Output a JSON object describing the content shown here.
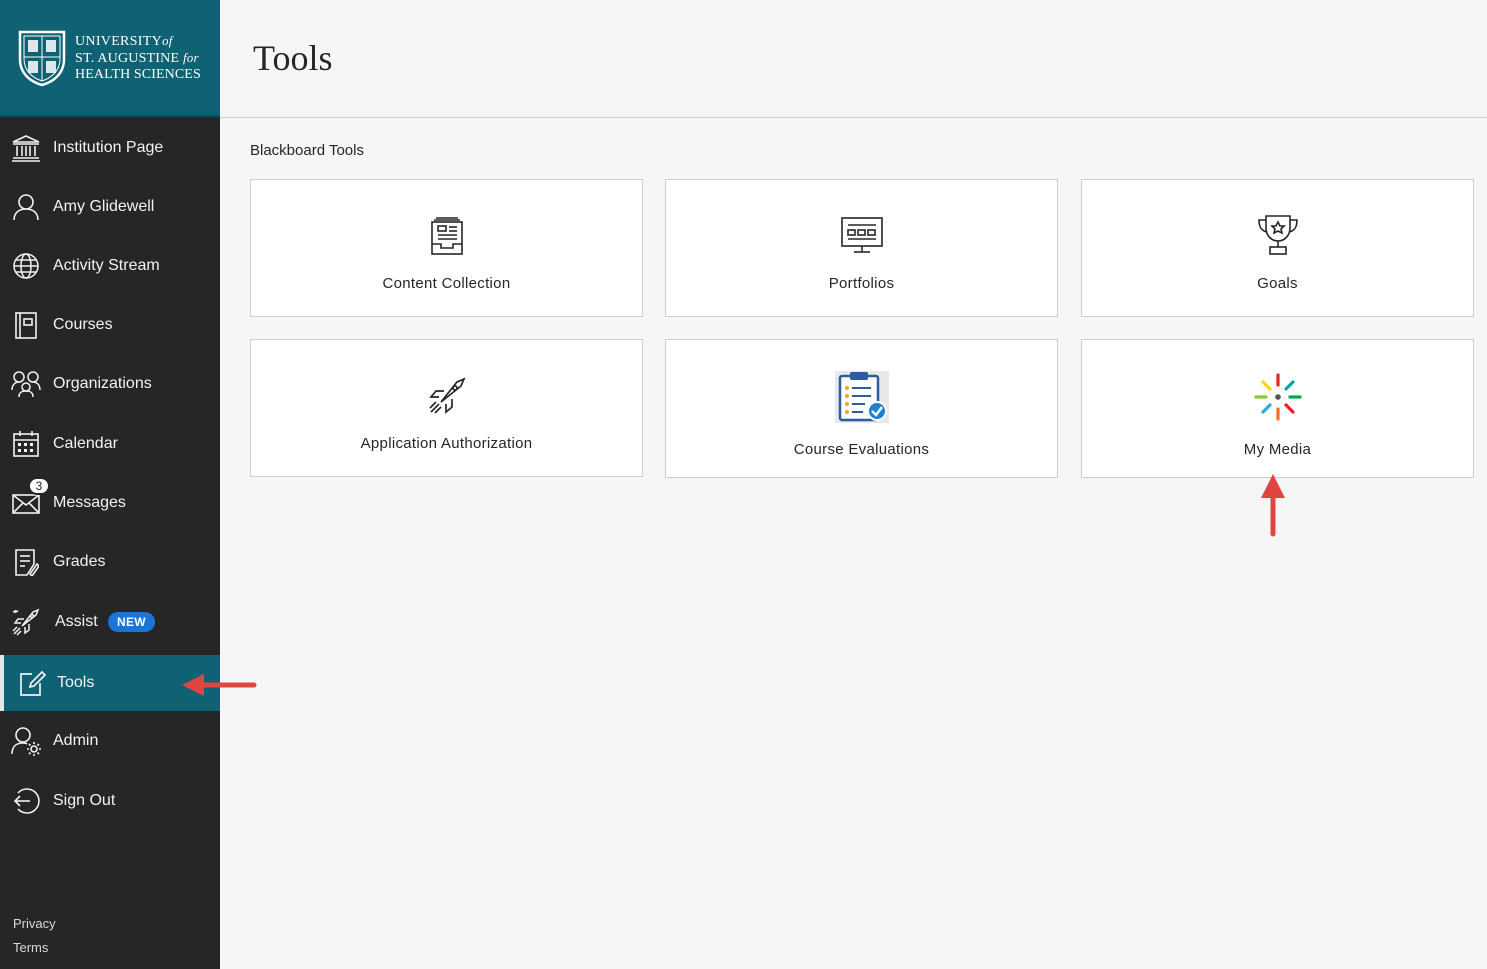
{
  "brand": {
    "line1": "University",
    "line1_suffix": "of",
    "line2": "St. Augustine",
    "line2_suffix": "for",
    "line3": "Health Sciences",
    "bg_color": "#0f6273"
  },
  "sidebar": {
    "items": [
      {
        "label": "Institution Page",
        "icon": "institution-icon"
      },
      {
        "label": "Amy Glidewell",
        "icon": "user-icon"
      },
      {
        "label": "Activity Stream",
        "icon": "globe-icon"
      },
      {
        "label": "Courses",
        "icon": "book-icon"
      },
      {
        "label": "Organizations",
        "icon": "group-icon"
      },
      {
        "label": "Calendar",
        "icon": "calendar-icon"
      },
      {
        "label": "Messages",
        "icon": "envelope-icon",
        "count": "3"
      },
      {
        "label": "Grades",
        "icon": "grades-icon"
      },
      {
        "label": "Assist",
        "icon": "rocket-icon",
        "badge": "NEW"
      },
      {
        "label": "Tools",
        "icon": "tools-icon",
        "active": true
      },
      {
        "label": "Admin",
        "icon": "admin-icon"
      },
      {
        "label": "Sign Out",
        "icon": "sign-out-icon"
      }
    ],
    "footer": {
      "privacy": "Privacy",
      "terms": "Terms"
    },
    "active_color": "#0f6273",
    "badge_color": "#1b74d6"
  },
  "main": {
    "title": "Tools",
    "section": "Blackboard Tools",
    "tiles": [
      {
        "label": "Content Collection",
        "icon": "content-collection-icon"
      },
      {
        "label": "Portfolios",
        "icon": "portfolio-icon"
      },
      {
        "label": "Goals",
        "icon": "trophy-icon"
      },
      {
        "label": "Application Authorization",
        "icon": "rocket-icon"
      },
      {
        "label": "Course Evaluations",
        "icon": "clipboard-check-icon"
      },
      {
        "label": "My Media",
        "icon": "kaltura-media-icon"
      }
    ]
  },
  "annotation_color": "#e0463f"
}
